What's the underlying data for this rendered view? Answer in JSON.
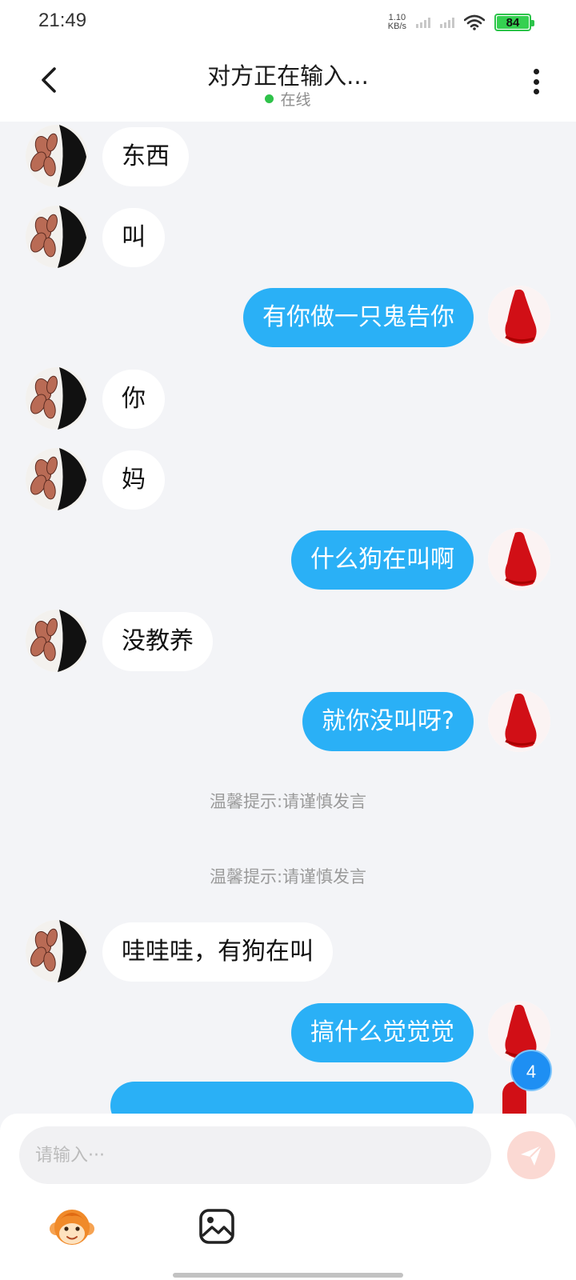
{
  "status_bar": {
    "time": "21:49",
    "net_speed_value": "1.10",
    "net_speed_unit": "KB/s",
    "battery_level": "84",
    "battery_color": "#35d051"
  },
  "header": {
    "back_icon": "chevron-left-icon",
    "title": "对方正在输入...",
    "status": "在线",
    "status_color": "#2fc24a",
    "more_icon": "more-vertical-icon"
  },
  "messages": [
    {
      "side": "left",
      "text": "东西"
    },
    {
      "side": "left",
      "text": "叫"
    },
    {
      "side": "right",
      "text": "有你做一只鬼告你"
    },
    {
      "side": "left",
      "text": "你"
    },
    {
      "side": "left",
      "text": "妈"
    },
    {
      "side": "right",
      "text": "什么狗在叫啊"
    },
    {
      "side": "left",
      "text": "没教养"
    },
    {
      "side": "right",
      "text": "就你没叫呀?"
    },
    {
      "side": "tip",
      "text": "温馨提示:请谨慎发言"
    },
    {
      "side": "tip",
      "text": "温馨提示:请谨慎发言"
    },
    {
      "side": "left",
      "text": "哇哇哇，有狗在叫"
    },
    {
      "side": "right",
      "text": "搞什么觉觉觉"
    }
  ],
  "unread_badge": "4",
  "accent_color": "#2ab0f6",
  "input": {
    "placeholder": "请输入···",
    "value": "",
    "send_icon": "send-icon",
    "emoji_icon": "monkey-emoji-icon",
    "image_icon": "image-icon"
  }
}
